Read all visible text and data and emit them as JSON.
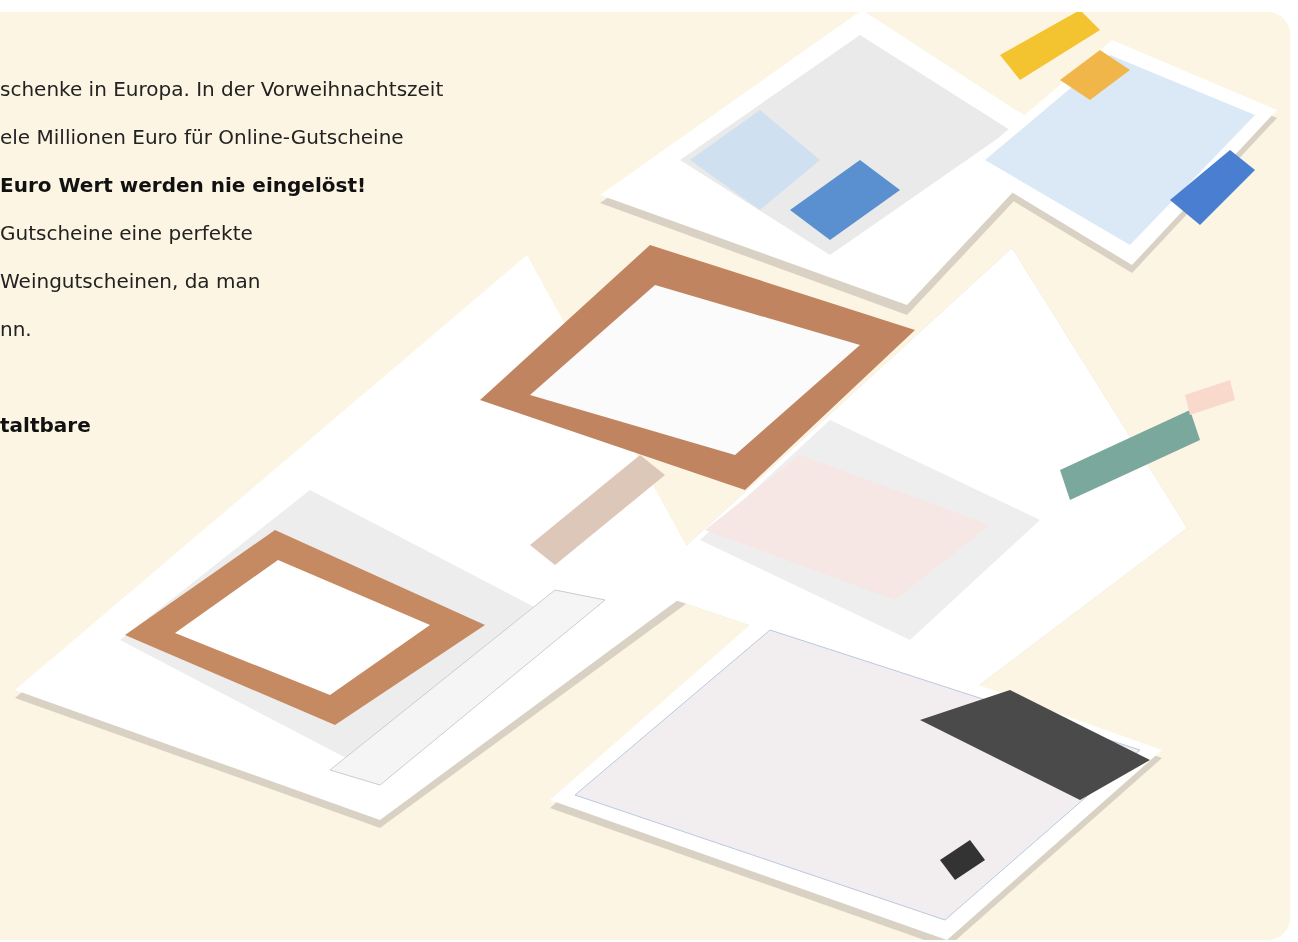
{
  "paragraphs": [
    {
      "lines": [
        {
          "text": "schenke in Europa. In der Vorweihnachtszeit",
          "kind": "regular"
        },
        {
          "text": "ele Millionen Euro für Online-Gutscheine",
          "kind": "regular"
        },
        {
          "text": "Euro Wert werden nie eingelöst!",
          "kind": "bold"
        },
        {
          "text": "Gutscheine eine perfekte",
          "kind": "regular"
        },
        {
          "text": "Weingutscheinen, da man",
          "kind": "regular"
        },
        {
          "text": "nn.",
          "kind": "regular"
        }
      ]
    },
    {
      "lines": [
        {
          "text": "taltbare",
          "kind": "bold"
        }
      ]
    }
  ]
}
